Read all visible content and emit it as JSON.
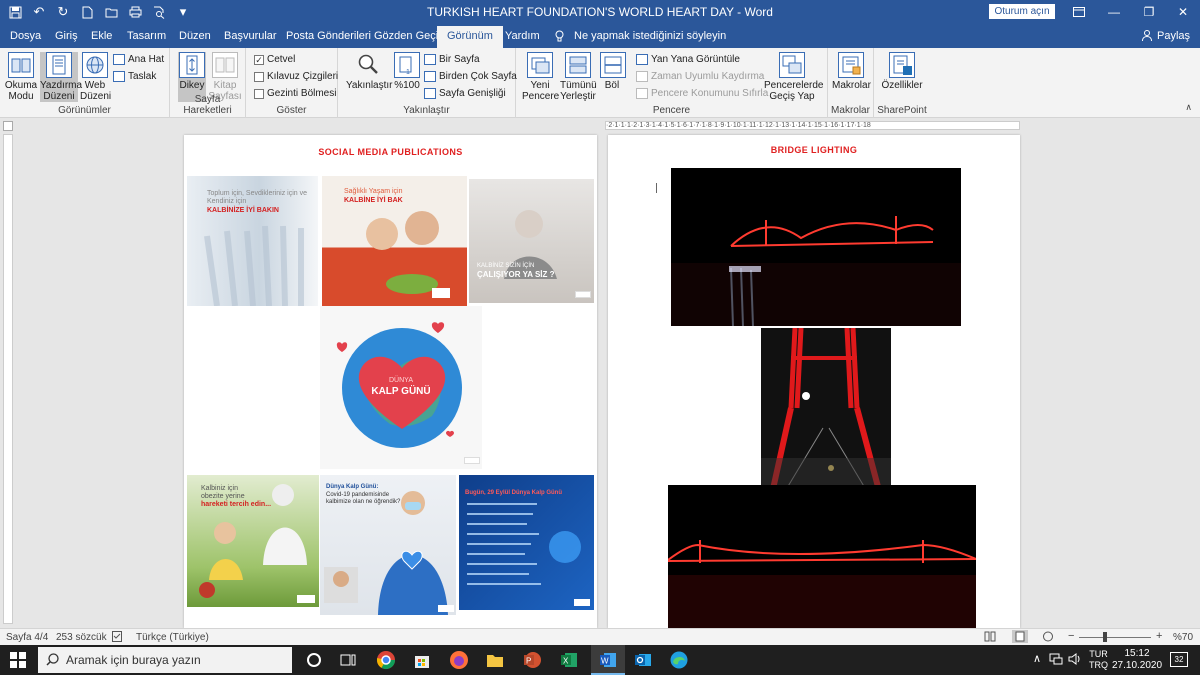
{
  "window": {
    "title": "TURKISH HEART FOUNDATION'S WORLD HEART DAY  -  Word",
    "signin_label": "Oturum açın"
  },
  "tabs": [
    "Dosya",
    "Giriş",
    "Ekle",
    "Tasarım",
    "Düzen",
    "Başvurular",
    "Posta Gönderileri",
    "Gözden Geçir",
    "Görünüm",
    "Yardım"
  ],
  "active_tab": "Görünüm",
  "tell_me": "Ne yapmak istediğinizi söyleyin",
  "share": "Paylaş",
  "ribbon": {
    "views": {
      "reading": "Okuma Modu",
      "print": "Yazdırma Düzeni",
      "web": "Web Düzeni",
      "outline": "Ana Hat",
      "draft": "Taslak",
      "label": "Görünümler"
    },
    "movement": {
      "vertical": "Dikey",
      "side": "Kitap Sayfası",
      "label": "Sayfa Hareketleri"
    },
    "show": {
      "ruler": "Cetvel",
      "gridlines": "Kılavuz Çizgileri",
      "nav": "Gezinti Bölmesi",
      "label": "Göster"
    },
    "zoom": {
      "zoom": "Yakınlaştır",
      "hundred": "%100",
      "one_page": "Bir Sayfa",
      "multi": "Birden Çok Sayfa",
      "width": "Sayfa Genişliği",
      "label": "Yakınlaştır"
    },
    "window": {
      "new": "Yeni Pencere",
      "arrange": "Tümünü Yerleştir",
      "split": "Böl",
      "side_by_side": "Yan Yana Görüntüle",
      "sync": "Zaman Uyumlu Kaydırma",
      "reset": "Pencere Konumunu Sıfırla",
      "switch": "Pencerelerde Geçiş Yap",
      "label": "Pencere"
    },
    "macros": {
      "macros": "Makrolar",
      "label": "Makrolar"
    },
    "sharepoint": {
      "props": "Özellikler",
      "label": "SharePoint"
    }
  },
  "ruler_text": "·2·1·1·1·2·1·3·1·4·1·5·1·6·1·7·1·8·1·9·1·10·1·11·1·12·1·13·1·14·1·15·1·16·1·17·1·18",
  "page1": {
    "title": "SOCIAL MEDIA PUBLICATIONS",
    "img1": {
      "line1": "Toplum için, Sevdikleriniz için ve Kendiniz için",
      "line2": "KALBİNİZE İYİ BAKIN"
    },
    "img2": {
      "line1": "Sağlıklı Yaşam için",
      "line2": "KALBİNE İYİ BAK"
    },
    "img3": {
      "line1": "KALBİNİZ SİZİN İÇİN",
      "line2": "ÇALIŞIYOR YA SİZ ?"
    },
    "img4": {
      "line1": "DÜNYA",
      "line2": "KALP GÜNÜ"
    },
    "img5": {
      "line1": "Kalbiniz için",
      "line2": "obezite yerine",
      "line3": "hareketi tercih edin..."
    },
    "img6": {
      "line1": "Dünya Kalp Günü:",
      "line2": "Covid-19 pandemisinde",
      "line3": "kalbimize olan ne öğrendik?"
    },
    "img7": {
      "line1": "Bugün, 29 Eylül Dünya Kalp Günü"
    }
  },
  "page2": {
    "title": "BRIDGE LIGHTING"
  },
  "status": {
    "page": "Sayfa 4/4",
    "words": "253 sözcük",
    "lang": "Türkçe (Türkiye)",
    "zoom": "%70"
  },
  "taskbar": {
    "search_placeholder": "Aramak için buraya yazın",
    "lang1": "TUR",
    "lang2": "TRQ",
    "time": "15:12",
    "date": "27.10.2020",
    "notif": "32"
  },
  "colors": {
    "accent": "#2b579a",
    "red": "#e02020"
  }
}
